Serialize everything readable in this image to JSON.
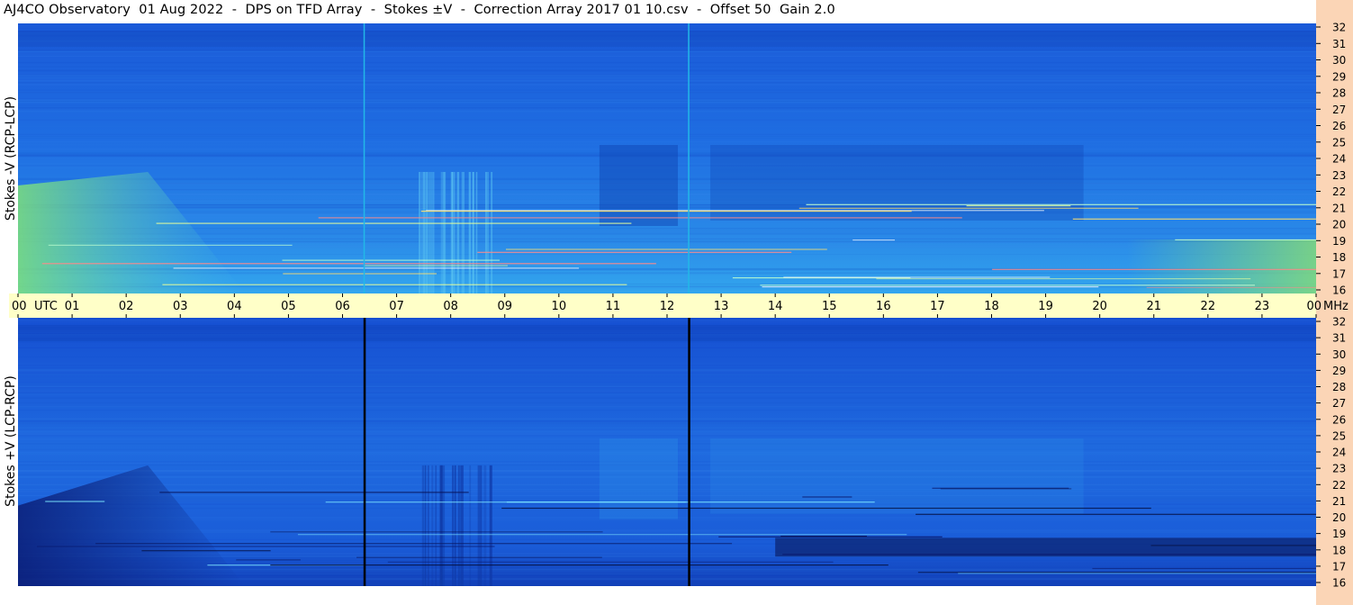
{
  "title": "AJ4CO Observatory  01 Aug 2022  -  DPS on TFD Array  -  Stokes ±V  -  Correction Array 2017 01 10.csv  -  Offset 50  Gain 2.0",
  "chart_data": [
    {
      "type": "heatmap",
      "panel": "top",
      "ylabel": "Stokes -V (RCP-LCP)",
      "y_ticks": [
        "32",
        "31",
        "30",
        "29",
        "28",
        "27",
        "26",
        "25",
        "24",
        "23",
        "22",
        "21",
        "20",
        "19",
        "18",
        "17",
        "16"
      ],
      "ylim": [
        16,
        32
      ],
      "y_unit": "MHz",
      "x_range_utc": [
        0,
        24
      ],
      "markers_utc": [
        6.4,
        12.4
      ],
      "marker_color": "#22b8e8"
    },
    {
      "type": "heatmap",
      "panel": "bottom",
      "ylabel": "Stokes +V (LCP-RCP)",
      "y_ticks": [
        "32",
        "31",
        "30",
        "29",
        "28",
        "27",
        "26",
        "25",
        "24",
        "23",
        "22",
        "21",
        "20",
        "19",
        "18",
        "17",
        "16"
      ],
      "ylim": [
        16,
        32
      ],
      "y_unit": "MHz",
      "x_range_utc": [
        0,
        24
      ],
      "markers_utc": [
        6.4,
        12.4
      ],
      "marker_color": "#000000"
    }
  ],
  "time_axis": {
    "ticks": [
      "00",
      "01",
      "02",
      "03",
      "04",
      "05",
      "06",
      "07",
      "08",
      "09",
      "10",
      "11",
      "12",
      "13",
      "14",
      "15",
      "16",
      "17",
      "18",
      "19",
      "20",
      "21",
      "22",
      "23",
      "00"
    ],
    "utc_label": "UTC",
    "mhz_label": "MHz"
  },
  "colors": {
    "band_bg": "#ffffc8",
    "side_strip": "#fbd5b6",
    "base_blue": "#1a6be0"
  }
}
